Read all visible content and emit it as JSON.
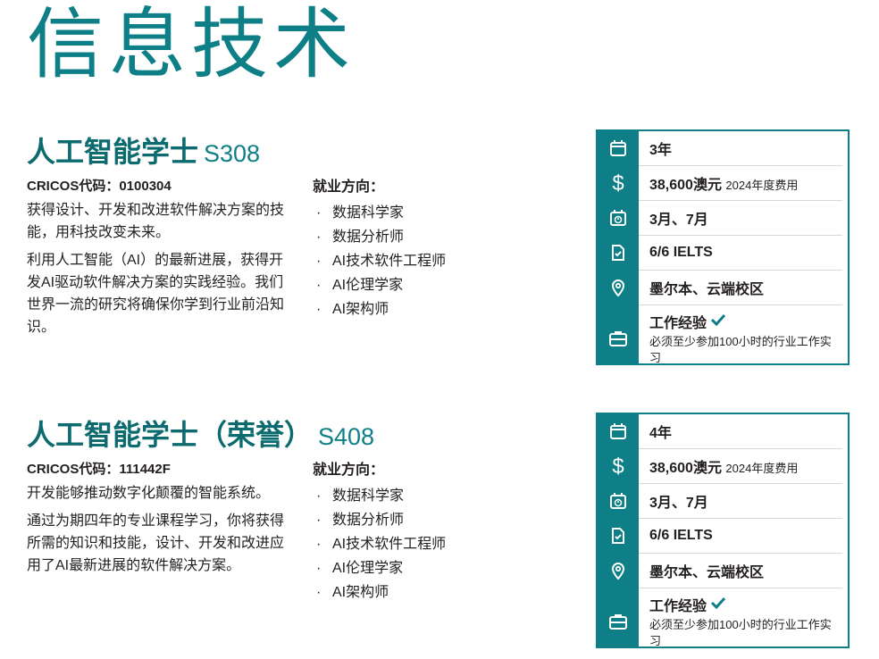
{
  "page_title": "信息技术",
  "programs": [
    {
      "title": "人工智能学士",
      "code": "S308",
      "cricos": "CRICOS代码：0100304",
      "desc": [
        "获得设计、开发和改进软件解决方案的技能，用科技改变未来。",
        "利用人工智能（AI）的最新进展，获得开发AI驱动软件解决方案的实践经验。我们世界一流的研究将确保你学到行业前沿知识。"
      ],
      "career_heading": "就业方向：",
      "careers": [
        "数据科学家",
        "数据分析师",
        "AI技术软件工程师",
        "AI伦理学家",
        "AI架构师"
      ],
      "info": {
        "duration": "3年",
        "fee": "38,600澳元",
        "fee_note": "2024年度费用",
        "intake": "3月、7月",
        "ielts": "6/6 IELTS",
        "campus": "墨尔本、云端校区",
        "work_exp": "工作经验",
        "work_note": "必须至少参加100小时的行业工作实习"
      }
    },
    {
      "title": "人工智能学士（荣誉）",
      "code": "S408",
      "cricos": "CRICOS代码：111442F",
      "desc": [
        "开发能够推动数字化颠覆的智能系统。",
        "通过为期四年的专业课程学习，你将获得所需的知识和技能，设计、开发和改进应用了AI最新进展的软件解决方案。"
      ],
      "career_heading": "就业方向：",
      "careers": [
        "数据科学家",
        "数据分析师",
        "AI技术软件工程师",
        "AI伦理学家",
        "AI架构师"
      ],
      "info": {
        "duration": "4年",
        "fee": "38,600澳元",
        "fee_note": "2024年度费用",
        "intake": "3月、7月",
        "ielts": "6/6 IELTS",
        "campus": "墨尔本、云端校区",
        "work_exp": "工作经验",
        "work_note": "必须至少参加100小时的行业工作实习"
      }
    }
  ],
  "colors": {
    "accent": "#0e7f86",
    "title_dark": "#0b6b6f"
  },
  "icons": [
    "calendar-icon",
    "dollar-icon",
    "calendar-clock-icon",
    "document-check-icon",
    "location-pin-icon",
    "briefcase-icon",
    "checkmark-icon"
  ]
}
